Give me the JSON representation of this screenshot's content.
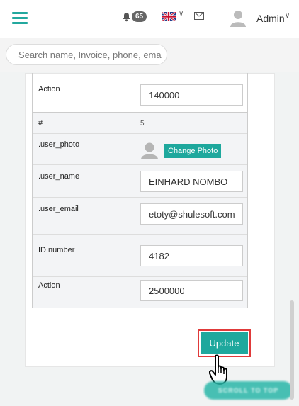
{
  "topbar": {
    "notification_count": "65",
    "user_name": "Admin"
  },
  "search": {
    "placeholder": "Search name, Invoice, phone, ema"
  },
  "form": {
    "prev_action_label": "Action",
    "prev_action_value": "140000",
    "rows": {
      "number_label": "#",
      "number_value": "5",
      "photo_label": ".user_photo",
      "change_photo": "Change Photo",
      "name_label": ".user_name",
      "name_value": "EINHARD NOMBO",
      "email_label": ".user_email",
      "email_value": "etoty@shulesoft.com",
      "id_label": "ID number",
      "id_value": "4182",
      "action_label": "Action",
      "action_value": "2500000"
    }
  },
  "update_label": "Update",
  "scroll_top_label": "SCROLL TO TOP"
}
